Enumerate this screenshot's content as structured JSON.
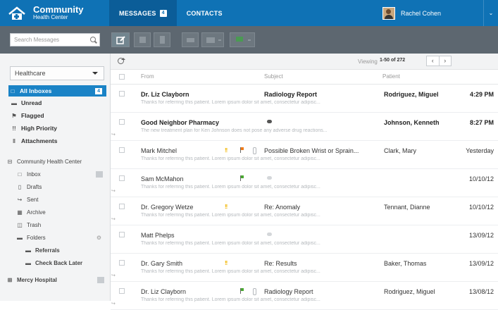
{
  "app": {
    "name": "Community",
    "subtitle": "Health Center"
  },
  "nav": {
    "messages_label": "MESSAGES",
    "messages_count": "4",
    "contacts_label": "CONTACTS"
  },
  "user": {
    "name": "Rachel Cohen"
  },
  "search": {
    "placeholder": "Search Messages"
  },
  "sidebar": {
    "dropdown_value": "Healthcare",
    "all_inboxes": {
      "label": "All Inboxes",
      "count": "4"
    },
    "items": [
      "Unread",
      "Flagged",
      "High Priority",
      "Attachments"
    ],
    "group1": {
      "label": "Community Health Center",
      "inbox": "Inbox",
      "drafts": "Drafts",
      "sent": "Sent",
      "archive": "Archive",
      "trash": "Trash",
      "folders": "Folders",
      "referrals": "Referrals",
      "check_back": "Check Back Later"
    },
    "group2": {
      "label": "Mercy Hospital"
    }
  },
  "list": {
    "viewing_label": "Viewing",
    "range": "1-50 of 272",
    "headers": {
      "from": "From",
      "subject": "Subject",
      "patient": "Patient"
    },
    "rows": [
      {
        "from": "Dr. Liz Clayborn",
        "subject": "Radiology Report",
        "patient": "Rodriguez, Miguel",
        "date": "4:29 PM",
        "preview": "Thanks for referring this patient. Lorem ipsum dolor sit amet, consectetur adipisc..."
      },
      {
        "from": "Good Neighbor Pharmacy",
        "subject": "",
        "patient": "Johnson, Kenneth",
        "date": "8:27 PM",
        "preview": "The new treatment plan for Ken Johnson does not pose any adverse drug reactions..."
      },
      {
        "from": "Mark Mitchel",
        "subject": "Possible Broken Wrist or Sprain...",
        "patient": "Clark, Mary",
        "date": "Yesterday",
        "preview": "Thanks for referring this patient. Lorem ipsum dolor sit amet, consectetur adipisc..."
      },
      {
        "from": "Sam McMahon",
        "subject": "",
        "patient": "",
        "date": "10/10/12",
        "preview": "Thanks for referring this patient. Lorem ipsum dolor sit amet, consectetur adipisc..."
      },
      {
        "from": "Dr. Gregory Wetze",
        "subject": "Re: Anomaly",
        "patient": "Tennant, Dianne",
        "date": "10/10/12",
        "preview": "Thanks for referring this patient. Lorem ipsum dolor sit amet, consectetur adipisc..."
      },
      {
        "from": "Matt Phelps",
        "subject": "",
        "patient": "",
        "date": "13/09/12",
        "preview": "Thanks for referring this patient. Lorem ipsum dolor sit amet, consectetur adipisc..."
      },
      {
        "from": "Dr. Gary Smith",
        "subject": "Re: Results",
        "patient": "Baker, Thomas",
        "date": "13/09/12",
        "preview": "Thanks for referring this patient. Lorem ipsum dolor sit amet, consectetur adipisc..."
      },
      {
        "from": "Dr. Liz Clayborn",
        "subject": "Radiology Report",
        "patient": "Rodriguez, Miguel",
        "date": "13/08/12",
        "preview": "Thanks for referring this patient. Lorem ipsum dolor sit amet, consectetur adipisc..."
      }
    ]
  },
  "colors": {
    "brand": "#0f72b5",
    "toolbar": "#5d6770",
    "active_item": "#1a83c6"
  }
}
